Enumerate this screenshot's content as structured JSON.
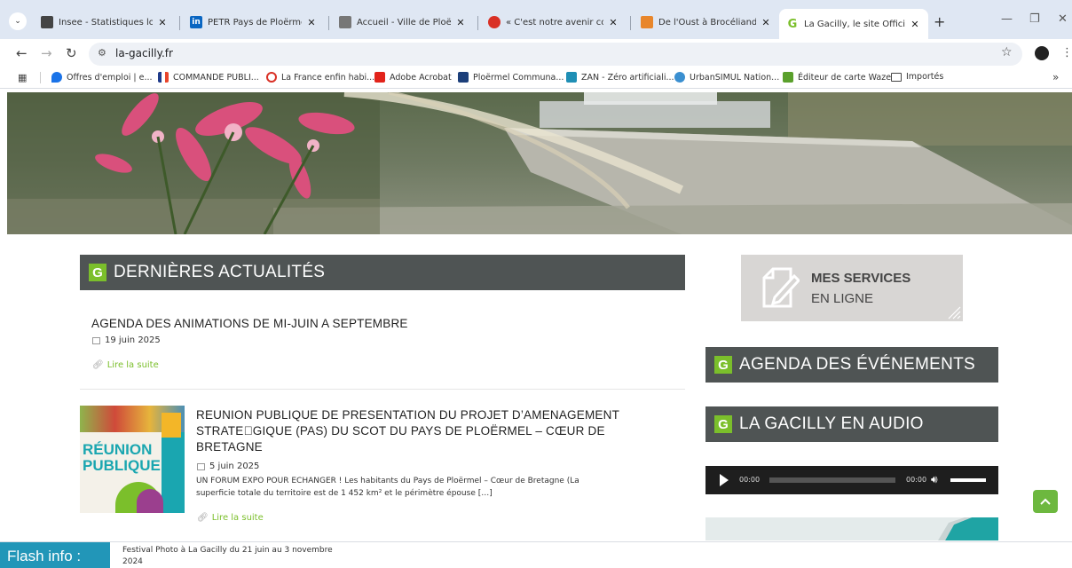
{
  "browser": {
    "tabs": [
      {
        "title": "Insee - Statistiques locales",
        "icon": "insee-icon",
        "color": "#444444"
      },
      {
        "title": "PETR Pays de Ploërmel - C",
        "icon": "linkedin-icon",
        "color": "#0a66c2"
      },
      {
        "title": "Accueil - Ville de Ploërmel",
        "icon": "ploermel-icon",
        "color": "#555555"
      },
      {
        "title": "« C'est notre avenir comm",
        "icon": "record-icon",
        "color": "#d93025"
      },
      {
        "title": "De l'Oust à Brocéliande Co",
        "icon": "oust-icon",
        "color": "#e8862b"
      },
      {
        "title": "La Gacilly, le site Officiel d",
        "icon": "gacilly-g-icon",
        "color": "#7bbf2b"
      }
    ],
    "url": "la-gacilly.fr",
    "bookmarks": [
      {
        "label": "Offres d'emploi | e...",
        "color": "#1a73e8"
      },
      {
        "label": "COMMANDE PUBLI...",
        "color": "#e8452b"
      },
      {
        "label": "La France enfin habi...",
        "color": "#d93025"
      },
      {
        "label": "Adobe Acrobat",
        "color": "#e2231a"
      },
      {
        "label": "Ploërmel Communa...",
        "color": "#1c3f7a"
      },
      {
        "label": "ZAN - Zéro artificiali...",
        "color": "#1f8fb5"
      },
      {
        "label": "UrbanSIMUL Nation...",
        "color": "#3a8fd0"
      },
      {
        "label": "Éditeur de carte Waze",
        "color": "#5aa02c"
      },
      {
        "label": "Importés",
        "color": "#444444"
      }
    ],
    "more_label": "»"
  },
  "news": {
    "section_title": "DERNIÈRES ACTUALITÉS",
    "badge": "G",
    "articles": [
      {
        "title": "AGENDA DES ANIMATIONS DE MI-JUIN A SEPTEMBRE",
        "date": "19 juin 2025",
        "read_more": "Lire la suite"
      },
      {
        "title_line1": "REUNION PUBLIQUE DE PRESENTATION DU PROJET D’AMENAGEMENT",
        "title_line2": "STRATE\u0000GIQUE (PAS) DU SCOT DU PAYS DE PLOËRMEL – CŒUR DE",
        "title_line3": "BRETAGNE",
        "date": "5 juin 2025",
        "excerpt_line1": "UN FORUM EXPO POUR ECHANGER ! Les habitants du Pays de Ploërmel – Cœur de Bretagne (La",
        "excerpt_line2": "superficie totale du territoire est de 1 452 km² et le périmètre épouse […]",
        "read_more": "Lire la suite",
        "thumb_text_1": "RÉUNION",
        "thumb_text_2": "PUBLIQUE"
      }
    ]
  },
  "sidebar": {
    "services_line1": "MES SERVICES",
    "services_line2": "EN LIGNE",
    "agenda_title": "AGENDA DES ÉVÉNEMENTS",
    "audio_title": "LA GACILLY EN AUDIO",
    "badge": "G",
    "audio_time_current": "00:00",
    "audio_time_total": "00:00"
  },
  "flash": {
    "label": "Flash info :",
    "text_line1": "Festival Photo à La Gacilly du 21 juin au 3 novembre",
    "text_line2": "2024"
  }
}
